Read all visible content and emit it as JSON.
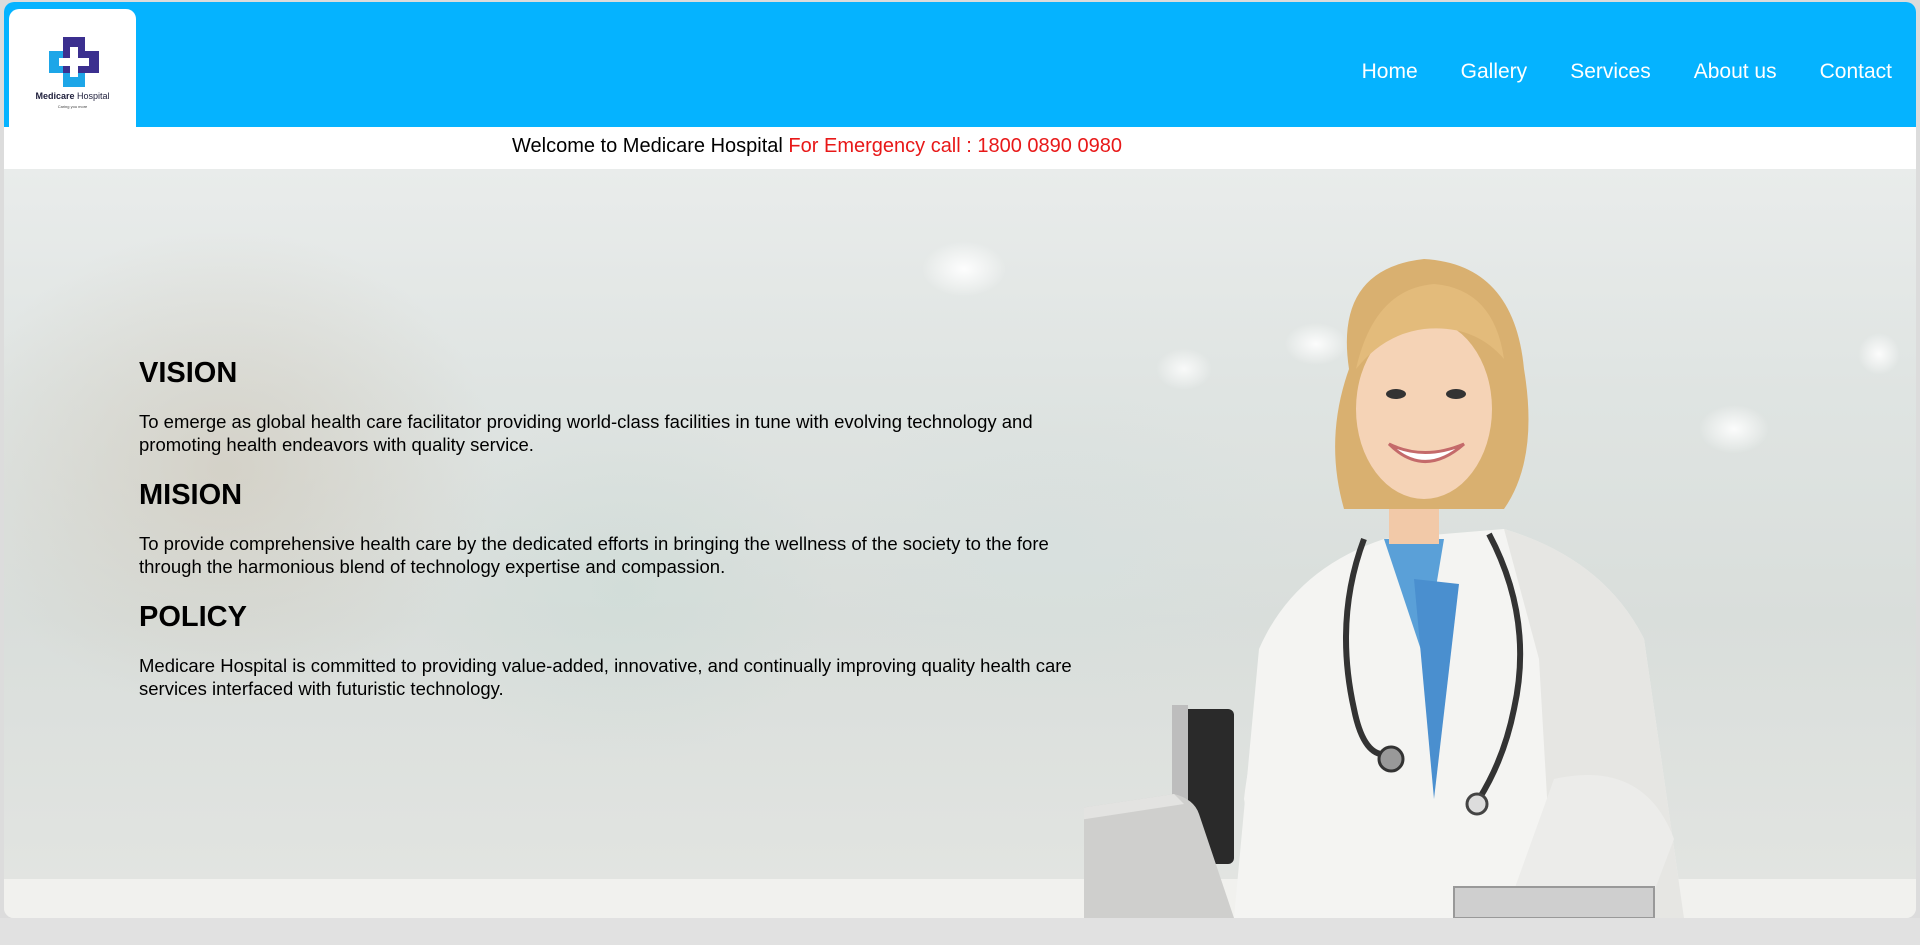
{
  "brand": {
    "name_bold": "Medicare",
    "name_light": " Hospital",
    "tagline": "Caring you more",
    "colors": {
      "nav_bg": "#05b3ff",
      "emergency": "#e81818",
      "logo_dark": "#3b2f8f",
      "logo_light": "#1da6e8"
    }
  },
  "nav": {
    "items": [
      {
        "label": "Home"
      },
      {
        "label": "Gallery"
      },
      {
        "label": "Services"
      },
      {
        "label": "About us"
      },
      {
        "label": "Contact"
      }
    ]
  },
  "ticker": {
    "welcome": "Welcome to Medicare Hospital",
    "emergency": "For Emergency call : 1800 0890 0980"
  },
  "sections": [
    {
      "heading": "VISION",
      "text": "To emerge as global health care facilitator providing world-class facilities in tune with evolving technology and promoting health endeavors with quality service."
    },
    {
      "heading": "MISION",
      "text": "To provide comprehensive health care by the dedicated efforts in bringing the wellness of the society to the fore through the harmonious blend of technology expertise and compassion."
    },
    {
      "heading": "POLICY",
      "text": "Medicare Hospital is committed to providing value-added, innovative, and continually improving quality health care services interfaced with futuristic technology."
    }
  ]
}
